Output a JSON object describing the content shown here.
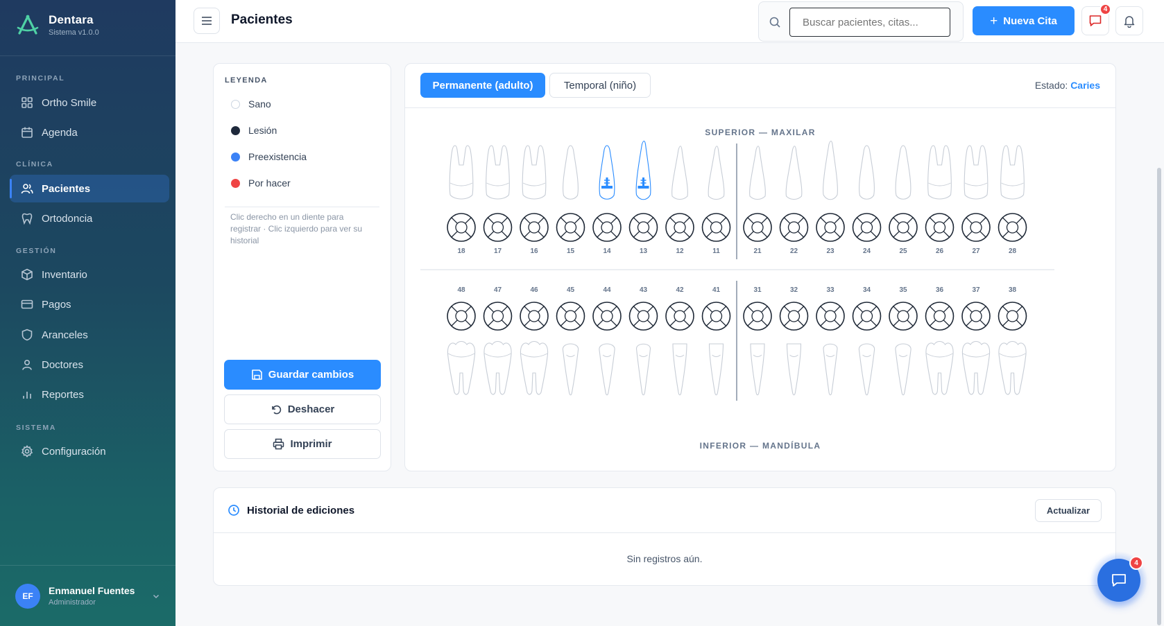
{
  "brand": {
    "name": "Dentara",
    "version": "Sistema v1.0.0"
  },
  "sidebar": {
    "sections": [
      {
        "label": "PRINCIPAL"
      },
      {
        "label": "CLÍNICA"
      },
      {
        "label": "GESTIÓN"
      },
      {
        "label": "SISTEMA"
      }
    ],
    "items": [
      {
        "label": "Ortho Smile",
        "icon": "grid-icon"
      },
      {
        "label": "Agenda",
        "icon": "calendar-icon"
      },
      {
        "label": "Pacientes",
        "icon": "users-icon",
        "active": true
      },
      {
        "label": "Ortodoncia",
        "icon": "tooth-icon"
      },
      {
        "label": "Inventario",
        "icon": "box-icon"
      },
      {
        "label": "Pagos",
        "icon": "card-icon"
      },
      {
        "label": "Aranceles",
        "icon": "shield-icon"
      },
      {
        "label": "Doctores",
        "icon": "user-icon"
      },
      {
        "label": "Reportes",
        "icon": "bar-chart-icon"
      },
      {
        "label": "Configuración",
        "icon": "gear-icon"
      }
    ],
    "user": {
      "initials": "EF",
      "name": "Enmanuel Fuentes",
      "role": "Administrador"
    }
  },
  "header": {
    "title": "Pacientes",
    "search_placeholder": "Buscar pacientes, citas...",
    "new_button": "Nueva Cita",
    "messages_badge": "4"
  },
  "legend": {
    "title": "LEYENDA",
    "items": [
      {
        "label": "Sano",
        "color": "#ffffff"
      },
      {
        "label": "Lesión",
        "color": "#1e293b"
      },
      {
        "label": "Preexistencia",
        "color": "#3b82f6"
      },
      {
        "label": "Por hacer",
        "color": "#ef4444"
      }
    ],
    "help": "Clic derecho en un diente para registrar · Clic izquierdo para ver su historial",
    "save": "Guardar cambios",
    "undo": "Deshacer",
    "print": "Imprimir"
  },
  "odontogram": {
    "tabs": {
      "permanent": "Permanente (adulto)",
      "temporary": "Temporal (niño)"
    },
    "estado_label": "Estado:",
    "estado_value": "Caries",
    "upper_label": "SUPERIOR — MAXILAR",
    "lower_label": "INFERIOR — MANDÍBULA",
    "upper_teeth": [
      "18",
      "17",
      "16",
      "15",
      "14",
      "13",
      "12",
      "11",
      "21",
      "22",
      "23",
      "24",
      "25",
      "26",
      "27",
      "28"
    ],
    "lower_teeth": [
      "48",
      "47",
      "46",
      "45",
      "44",
      "43",
      "42",
      "41",
      "31",
      "32",
      "33",
      "34",
      "35",
      "36",
      "37",
      "38"
    ],
    "preexistencia_teeth": [
      "14",
      "13"
    ],
    "colors": {
      "accent": "#2a8cff",
      "outline": "#1f2937",
      "tooth": "#c7cdd6"
    }
  },
  "history": {
    "title": "Historial de ediciones",
    "refresh": "Actualizar",
    "empty": "Sin registros aún."
  },
  "chat": {
    "badge": "4"
  }
}
